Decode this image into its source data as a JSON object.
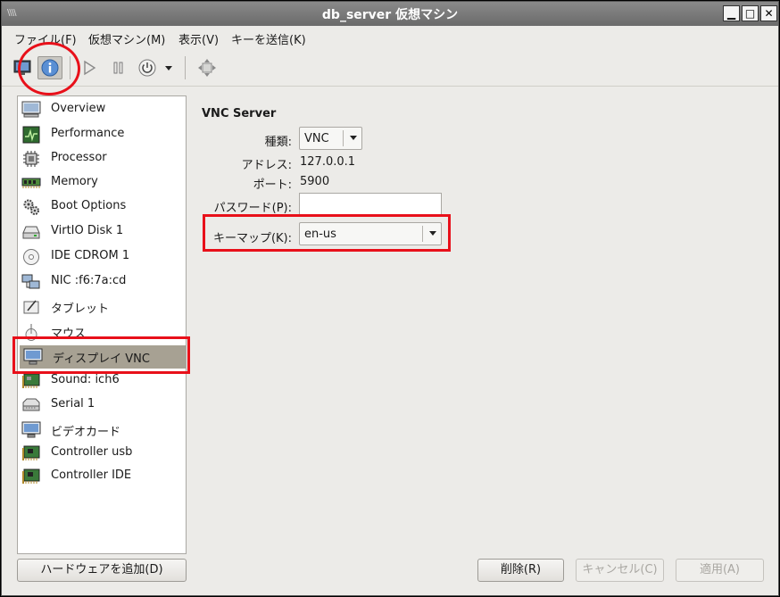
{
  "window": {
    "title": "db_server 仮想マシン",
    "wm_icon": "\\\\\\\\",
    "minimize_glyph": "▁",
    "maximize_glyph": "□",
    "close_glyph": "✕"
  },
  "menubar": [
    {
      "label": "ファイル(F)"
    },
    {
      "label": "仮想マシン(M)"
    },
    {
      "label": "表示(V)"
    },
    {
      "label": "キーを送信(K)"
    }
  ],
  "toolbar": {
    "icons": [
      "console-icon",
      "info-icon",
      "run-icon",
      "pause-icon",
      "power-icon",
      "power-menu-icon",
      "fullscreen-icon"
    ]
  },
  "sidebar": {
    "items": [
      {
        "label": "Overview",
        "icon": "monitor-icon"
      },
      {
        "label": "Performance",
        "icon": "performance-icon"
      },
      {
        "label": "Processor",
        "icon": "cpu-icon"
      },
      {
        "label": "Memory",
        "icon": "memory-icon"
      },
      {
        "label": "Boot Options",
        "icon": "gears-icon"
      },
      {
        "label": "VirtIO Disk 1",
        "icon": "disk-icon"
      },
      {
        "label": "IDE CDROM 1",
        "icon": "cdrom-icon"
      },
      {
        "label": "NIC :f6:7a:cd",
        "icon": "network-icon"
      },
      {
        "label": "タブレット",
        "icon": "tablet-icon"
      },
      {
        "label": "マウス",
        "icon": "mouse-icon"
      },
      {
        "label": "ディスプレイ VNC",
        "icon": "display-icon",
        "selected": true
      },
      {
        "label": "Sound: ich6",
        "icon": "sound-card-icon"
      },
      {
        "label": "Serial 1",
        "icon": "serial-icon"
      },
      {
        "label": "ビデオカード",
        "icon": "video-card-icon"
      },
      {
        "label": "Controller usb",
        "icon": "controller-icon"
      },
      {
        "label": "Controller IDE",
        "icon": "controller-icon"
      }
    ]
  },
  "vnc": {
    "section_title": "VNC Server",
    "type_label": "種類:",
    "type_value": "VNC",
    "address_label": "アドレス:",
    "address_value": "127.0.0.1",
    "port_label": "ポート:",
    "port_value": "5900",
    "password_label": "パスワード(P):",
    "password_value": "",
    "keymap_label": "キーマップ(K):",
    "keymap_value": "en-us"
  },
  "buttons": {
    "add_hardware": "ハードウェアを追加(D)",
    "remove": "削除(R)",
    "cancel": "キャンセル(C)",
    "apply": "適用(A)"
  },
  "colors": {
    "highlight_red": "#e8101a",
    "selected_bg": "#a7a193",
    "window_bg": "#ecebe8"
  }
}
